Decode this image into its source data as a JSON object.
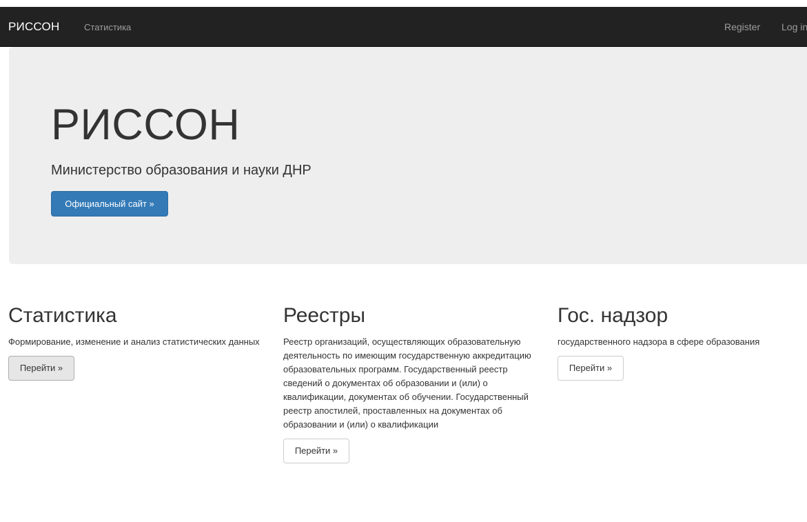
{
  "navbar": {
    "brand": "РИССОН",
    "links": [
      "Статистика"
    ],
    "register": "Register",
    "login": "Log in"
  },
  "hero": {
    "title": "РИССОН",
    "subtitle": "Министерство образования и науки ДНР",
    "button": "Официальный сайт »"
  },
  "columns": [
    {
      "title": "Статистика",
      "text": "Формирование, изменение и анализ статистических данных",
      "button": "Перейти »"
    },
    {
      "title": "Реестры",
      "text": "Реестр организаций, осуществляющих образовательную деятельность по имеющим государственную аккредитацию образовательных программ. Государственный реестр сведений о документах об образовании и (или) о квалификации, документах об обучении. Государственный реестр апостилей, проставленных на документах об образовании и (или) о квалификации",
      "button": "Перейти »"
    },
    {
      "title": "Гос. надзор",
      "text": "государственного надзора в сфере образования",
      "button": "Перейти »"
    }
  ],
  "colors": {
    "navbar_bg": "#222222",
    "navbar_link": "#9d9d9d",
    "jumbotron_bg": "#eeeeee",
    "primary": "#337ab7"
  }
}
